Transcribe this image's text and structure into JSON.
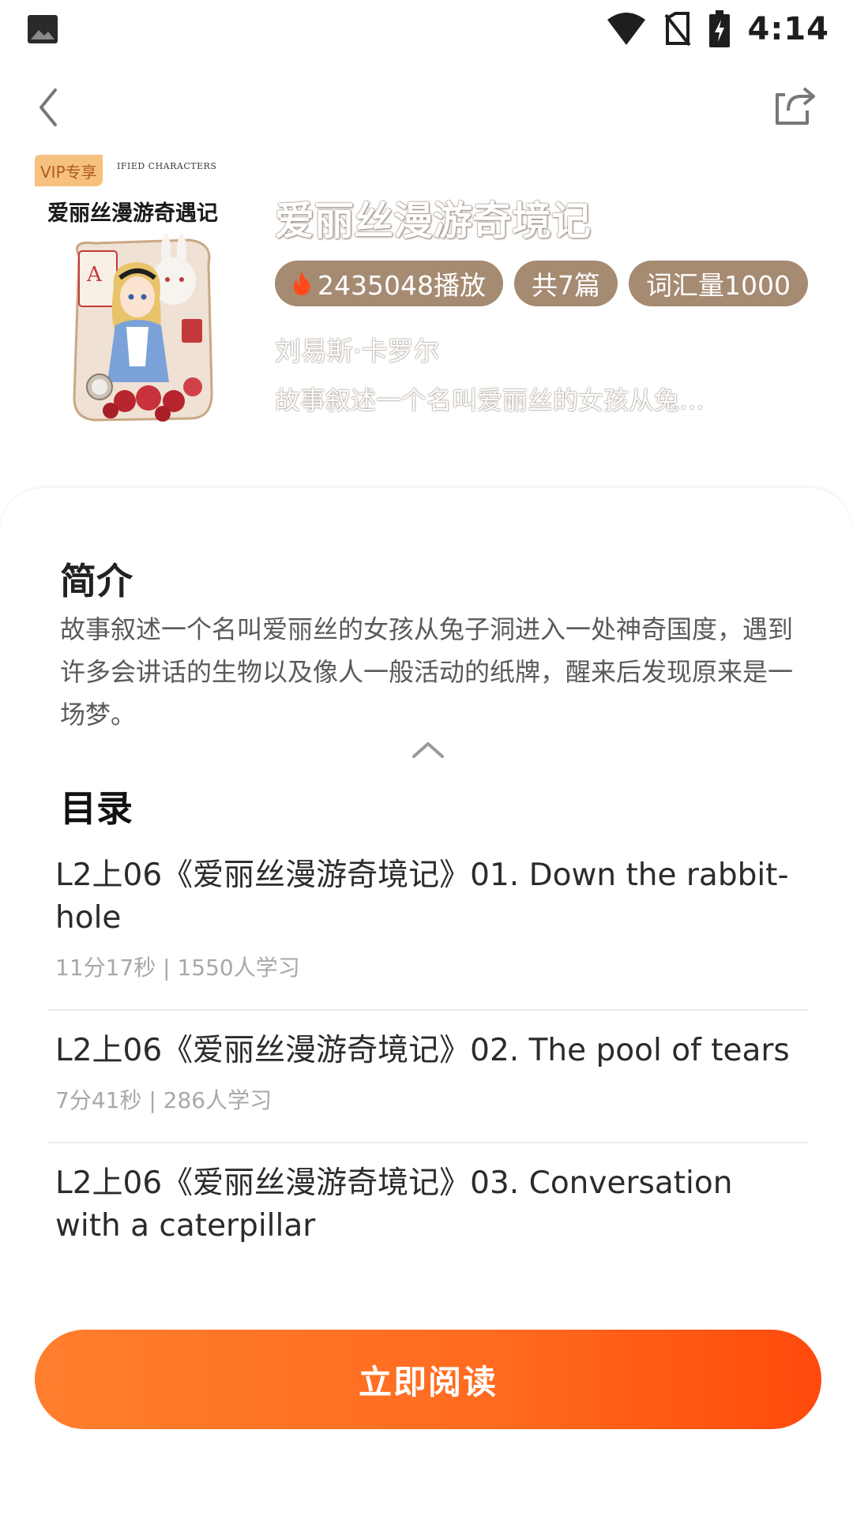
{
  "status_bar": {
    "time": "4:14",
    "icons": [
      "image-icon",
      "wifi-icon",
      "no-sim-icon",
      "battery-charging-icon"
    ]
  },
  "nav": {
    "back_icon": "chevron-left-icon",
    "share_icon": "share-icon"
  },
  "book": {
    "vip_badge": "VIP专享",
    "cover_subtitle": "IFIED CHARACTERS",
    "cover_title": "爱丽丝漫游奇遇记",
    "title": "爱丽丝漫游奇境记",
    "tags": {
      "plays": "2435048播放",
      "chapters": "共7篇",
      "vocabulary": "词汇量1000"
    },
    "author": "刘易斯·卡罗尔",
    "short_description": "故事叙述一个名叫爱丽丝的女孩从兔…"
  },
  "intro": {
    "heading": "简介",
    "text": "故事叙述一个名叫爱丽丝的女孩从兔子洞进入一处神奇国度，遇到许多会讲话的生物以及像人一般活动的纸牌，醒来后发现原来是一场梦。"
  },
  "toc": {
    "heading": "目录",
    "items": [
      {
        "title": "L2上06《爱丽丝漫游奇境记》01. Down the rabbit-hole",
        "meta": "11分17秒 | 1550人学习"
      },
      {
        "title": "L2上06《爱丽丝漫游奇境记》02. The pool of tears",
        "meta": "7分41秒 | 286人学习"
      },
      {
        "title": "L2上06《爱丽丝漫游奇境记》03. Conversation with a caterpillar",
        "meta": ""
      }
    ]
  },
  "actions": {
    "read_now": "立即阅读"
  },
  "colors": {
    "accent_orange": "#ff6a1f",
    "tag_brown": "#a58b72",
    "vip_badge": "#f6c07f"
  }
}
